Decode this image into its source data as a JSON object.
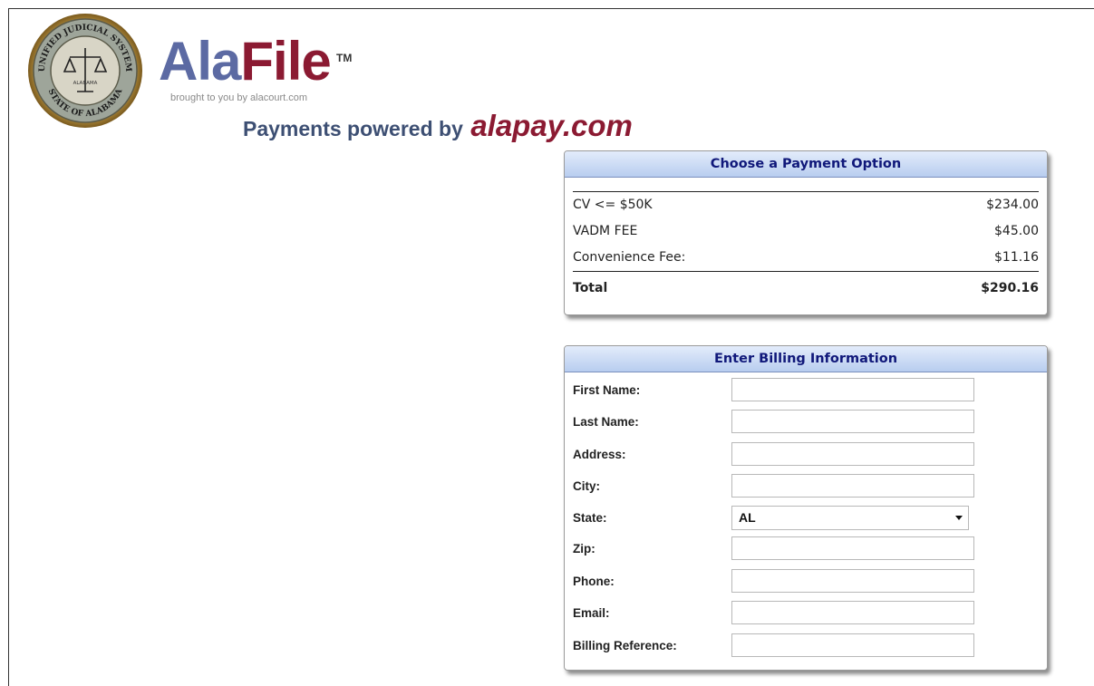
{
  "header": {
    "seal": {
      "top_text": "UNIFIED JUDICIAL SYSTEM",
      "bottom_text": "STATE OF ALABAMA",
      "inner_text": "ALABAMA"
    },
    "brand_part1": "Ala",
    "brand_part2": "File",
    "trademark": "TM",
    "tagline": "brought to you by alacourt.com",
    "powered_prefix": "Payments powered by",
    "powered_brand": "alapay.com"
  },
  "payment": {
    "title": "Choose a Payment Option",
    "items": [
      {
        "label": "CV <= $50K",
        "amount": "$234.00"
      },
      {
        "label": "VADM FEE",
        "amount": "$45.00"
      },
      {
        "label": "Convenience Fee:",
        "amount": "$11.16"
      }
    ],
    "total_label": "Total",
    "total_amount": "$290.16"
  },
  "billing": {
    "title": "Enter Billing Information",
    "first_name_label": "First Name:",
    "last_name_label": "Last Name:",
    "address_label": "Address:",
    "city_label": "City:",
    "state_label": "State:",
    "state_value": "AL",
    "zip_label": "Zip:",
    "phone_label": "Phone:",
    "email_label": "Email:",
    "billing_reference_label": "Billing Reference:"
  },
  "colors": {
    "brand_blue": "#5c6aa3",
    "brand_red": "#8b1a32",
    "panel_title": "#10187a"
  }
}
